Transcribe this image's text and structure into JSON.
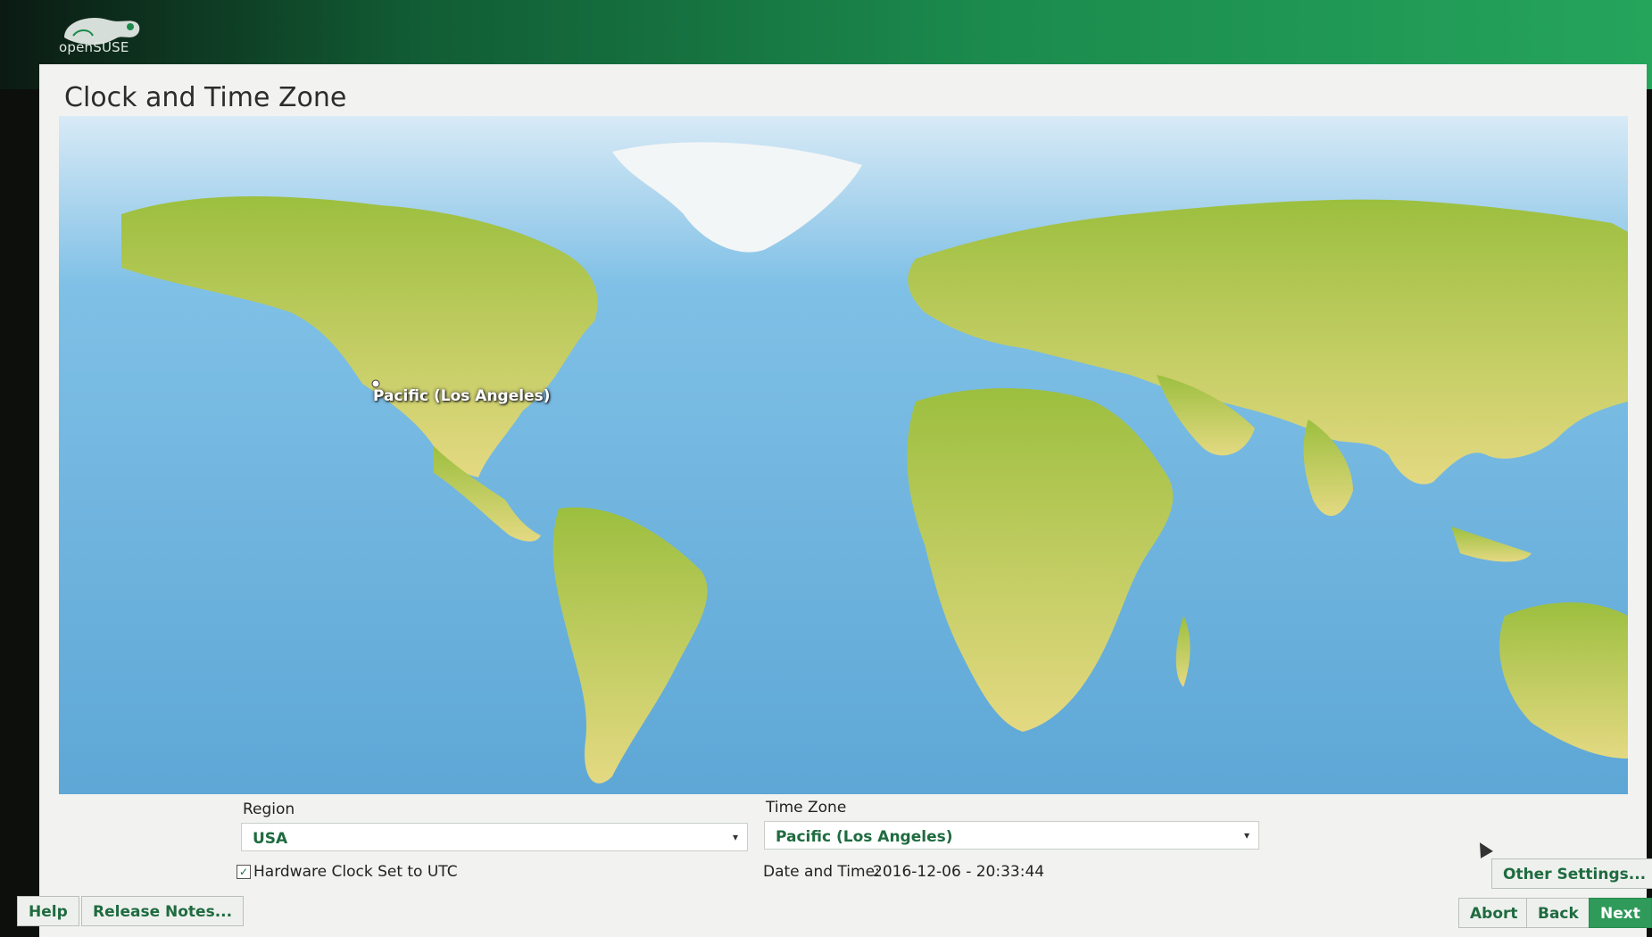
{
  "brand": {
    "logo_text": "openSUSE"
  },
  "page": {
    "title": "Clock and Time Zone"
  },
  "map": {
    "selected_zone_label": "Pacific (Los Angeles)"
  },
  "region": {
    "label": "Region",
    "value": "USA"
  },
  "timezone": {
    "label": "Time Zone",
    "value": "Pacific (Los Angeles)"
  },
  "hw_clock": {
    "label": "Hardware Clock Set to UTC",
    "checked": true
  },
  "datetime": {
    "label": "Date and Time:",
    "value": "2016-12-06 - 20:33:44"
  },
  "buttons": {
    "other_settings": "Other Settings...",
    "help": "Help",
    "release_notes": "Release Notes...",
    "abort": "Abort",
    "back": "Back",
    "next": "Next"
  },
  "colors": {
    "accent": "#2f9a5a",
    "ocean": "#6fb0db",
    "land": "#cfd96a",
    "header": "#1b8b4d"
  }
}
